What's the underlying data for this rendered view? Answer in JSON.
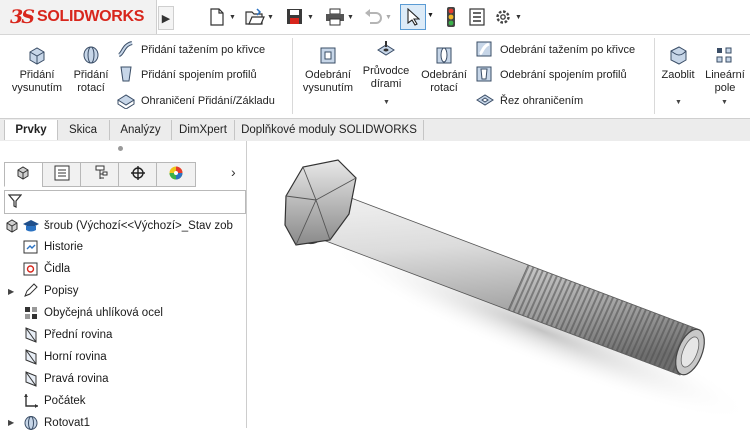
{
  "app": {
    "logo_prefix": "3S",
    "logo_name": "SOLIDWORKS"
  },
  "quick_access": {
    "icons": [
      "new-document-icon",
      "open-folder-icon",
      "save-icon",
      "print-icon",
      "undo-icon",
      "select-pointer-icon",
      "traffic-light-icon",
      "file-properties-icon",
      "options-gear-icon"
    ]
  },
  "ribbon": {
    "pridani_vysunutim": "Přidání\nvysunutím",
    "pridani_rotaci": "Přidání\nrotací",
    "pridani_tazenim": "Přidání tažením po křivce",
    "pridani_spojenim": "Přidání spojením profilů",
    "ohraniceni_pridani": "Ohraničení Přidání/Základu",
    "odebrani_vysunutim": "Odebrání\nvysunutím",
    "pruvodce_dirami": "Průvodce\ndírami",
    "odebrani_rotaci": "Odebrání\nrotací",
    "odebrani_tazenim": "Odebrání tažením po křivce",
    "odebrani_spojenim": "Odebrání spojením profilů",
    "rez_ohranicenim": "Řez ohraničením",
    "zaoblit": "Zaoblit",
    "linearni_pole": "Lineární\npole"
  },
  "tabs": [
    {
      "label": "Prvky",
      "active": true
    },
    {
      "label": "Skica",
      "active": false
    },
    {
      "label": "Analýzy",
      "active": false
    },
    {
      "label": "DimXpert",
      "active": false
    },
    {
      "label": "Doplňkové moduly SOLIDWORKS",
      "active": false
    }
  ],
  "feature_tree": {
    "root": "šroub  (Výchozí<<Výchozí>_Stav zob",
    "items": [
      {
        "label": "Historie",
        "icon": "history-icon",
        "expandable": false
      },
      {
        "label": "Čidla",
        "icon": "sensor-icon",
        "expandable": false
      },
      {
        "label": "Popisy",
        "icon": "annotations-icon",
        "expandable": true
      },
      {
        "label": "Obyčejná uhlíková ocel",
        "icon": "material-icon",
        "expandable": false
      },
      {
        "label": "Přední rovina",
        "icon": "plane-icon",
        "expandable": false
      },
      {
        "label": "Horní rovina",
        "icon": "plane-icon",
        "expandable": false
      },
      {
        "label": "Pravá rovina",
        "icon": "plane-icon",
        "expandable": false
      },
      {
        "label": "Počátek",
        "icon": "origin-icon",
        "expandable": false
      },
      {
        "label": "Rotovat1",
        "icon": "revolve-icon",
        "expandable": true
      }
    ]
  },
  "colors": {
    "brand_red": "#d8261c",
    "selection_blue": "#dcebf8"
  }
}
